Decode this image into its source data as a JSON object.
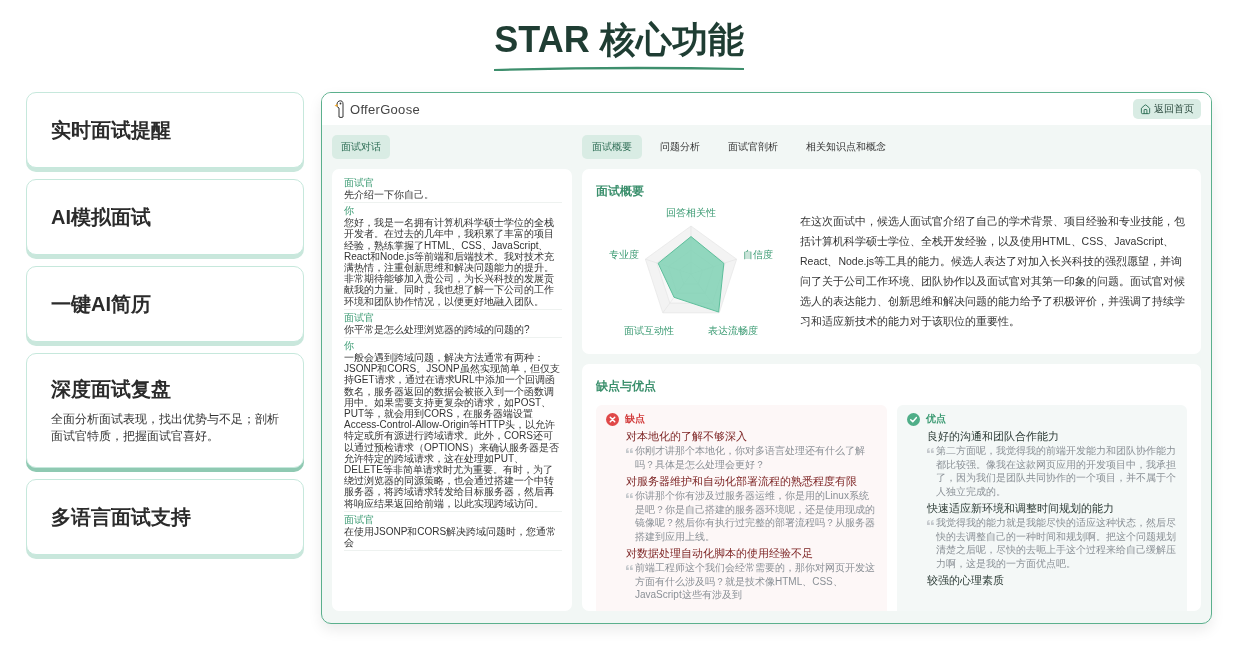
{
  "page_title": "STAR 核心功能",
  "features": [
    {
      "title": "实时面试提醒",
      "selected": false
    },
    {
      "title": "AI模拟面试",
      "selected": false
    },
    {
      "title": "一键AI简历",
      "selected": false
    },
    {
      "title": "深度面试复盘",
      "description": "全面分析面试表现，找出优势与不足；剖析面试官特质，把握面试官喜好。",
      "selected": true
    },
    {
      "title": "多语言面试支持",
      "selected": false
    }
  ],
  "app": {
    "logo": "OfferGoose",
    "home_button": "返回首页",
    "chat_tab": "面试对话",
    "chat": [
      {
        "speaker": "面试官",
        "text": "先介绍一下你自己。"
      },
      {
        "speaker": "你",
        "text": "您好，我是一名拥有计算机科学硕士学位的全栈开发者。在过去的几年中，我积累了丰富的项目经验，熟练掌握了HTML、CSS、JavaScript、React和Node.js等前端和后端技术。我对技术充满热情，注重创新思维和解决问题能力的提升。非常期待能够加入贵公司，为长兴科技的发展贡献我的力量。同时，我也想了解一下公司的工作环境和团队协作情况，以便更好地融入团队。"
      },
      {
        "speaker": "面试官",
        "text": "你平常是怎么处理浏览器的跨域的问题的?"
      },
      {
        "speaker": "你",
        "text": "一般会遇到跨域问题，解决方法通常有两种：JSONP和CORS。JSONP虽然实现简单，但仅支持GET请求，通过在请求URL中添加一个回调函数名，服务器返回的数据会被嵌入到一个函数调用中。如果需要支持更复杂的请求，如POST、PUT等，就会用到CORS，在服务器端设置Access-Control-Allow-Origin等HTTP头，以允许特定或所有源进行跨域请求。此外，CORS还可以通过预检请求（OPTIONS）来确认服务器是否允许特定的跨域请求，这在处理如PUT、DELETE等非简单请求时尤为重要。有时，为了绕过浏览器的同源策略，也会通过搭建一个中转服务器，将跨域请求转发给目标服务器，然后再将响应结果返回给前端，以此实现跨域访问。"
      },
      {
        "speaker": "面试官",
        "text": "在使用JSONP和CORS解决跨域问题时，您通常会"
      }
    ],
    "tabs": [
      {
        "label": "面试概要",
        "selected": true
      },
      {
        "label": "问题分析",
        "selected": false
      },
      {
        "label": "面试官剖析",
        "selected": false
      },
      {
        "label": "相关知识点和概念",
        "selected": false
      }
    ],
    "overview": {
      "title": "面试概要",
      "radar_labels": [
        "回答相关性",
        "专业度",
        "自信度",
        "面试互动性",
        "表达流畅度"
      ],
      "summary": "在这次面试中，候选人面试官介绍了自己的学术背景、项目经验和专业技能，包括计算机科学硕士学位、全栈开发经验，以及使用HTML、CSS、JavaScript、React、Node.js等工具的能力。候选人表达了对加入长兴科技的强烈愿望，并询问了关于公司工作环境、团队协作以及面试官对其第一印象的问题。面试官对候选人的表达能力、创新思维和解决问题的能力给予了积极评价，并强调了持续学习和适应新技术的能力对于该职位的重要性。"
    },
    "pros_cons": {
      "title": "缺点与优点",
      "columns": [
        {
          "kind": "cons",
          "label": "缺点",
          "items": [
            {
              "title": "对本地化的了解不够深入",
              "quote": "你刚才讲那个本地化，你对多语言处理还有什么了解吗？具体是怎么处理会更好？"
            },
            {
              "title": "对服务器维护和自动化部署流程的熟悉程度有限",
              "quote": "你讲那个你有涉及过服务器运维，你是用的Linux系统是吧？你是自己搭建的服务器环境呢，还是使用现成的镜像呢？然后你有执行过完整的部署流程吗？从服务器搭建到应用上线。"
            },
            {
              "title": "对数据处理自动化脚本的使用经验不足",
              "quote": "前端工程师这个我们会经常需要的，那你对网页开发这方面有什么涉及吗？就是技术像HTML、CSS、JavaScript这些有涉及到"
            }
          ]
        },
        {
          "kind": "pros",
          "label": "优点",
          "items": [
            {
              "title": "良好的沟通和团队合作能力",
              "quote": "第二方面呢，我觉得我的前端开发能力和团队协作能力都比较强。像我在这款网页应用的开发项目中，我承担了，因为我们是团队共同协作的一个项目，并不属于个人独立完成的。"
            },
            {
              "title": "快速适应新环境和调整时间规划的能力",
              "quote": "我觉得我的能力就是我能尽快的适应这种状态，然后尽快的去调整自己的一种时间和规划啊。把这个问题规划清楚之后呢，尽快的去呃上手这个过程来给自己缓解压力啊，这是我的一方面优点吧。"
            },
            {
              "title": "较强的心理素质"
            }
          ]
        }
      ]
    }
  }
}
